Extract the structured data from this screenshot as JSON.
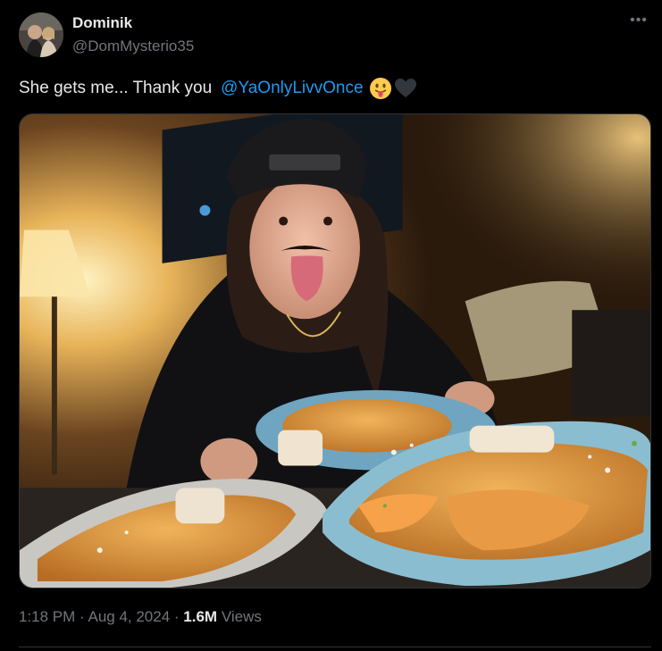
{
  "author": {
    "name": "Dominik",
    "handle": "@DomMysterio35"
  },
  "tweet": {
    "text": "She gets me... Thank you",
    "mention": "@YaOnlyLivvOnce",
    "emojis": [
      "tongue-out-face-icon",
      "black-heart-icon"
    ]
  },
  "meta": {
    "time": "1:18 PM",
    "separator1": " · ",
    "date": "Aug 4, 2024",
    "separator2": " · ",
    "views_count": "1.6M",
    "views_label": "Views"
  },
  "colors": {
    "background": "#000000",
    "text": "#e7e9ea",
    "muted": "#71767b",
    "link": "#1d9bf0",
    "divider": "#2f3336"
  }
}
